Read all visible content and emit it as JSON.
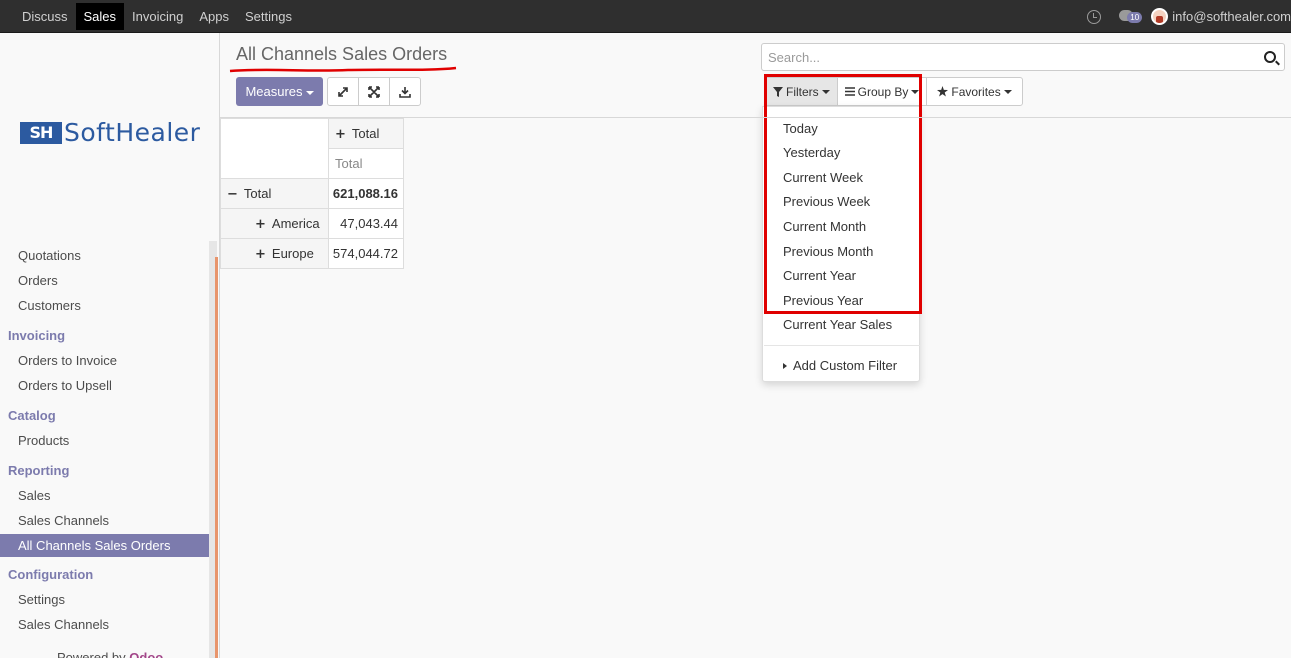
{
  "topbar": {
    "menu": [
      "Discuss",
      "Sales",
      "Invoicing",
      "Apps",
      "Settings"
    ],
    "active_menu": "Sales",
    "chat_count": "10",
    "user_email": "info@softhealer.com"
  },
  "logo": {
    "mark": "SH",
    "word": "SoftHealer"
  },
  "sidebar": {
    "items": [
      {
        "type": "item",
        "label": "Quotations"
      },
      {
        "type": "item",
        "label": "Orders"
      },
      {
        "type": "item",
        "label": "Customers"
      },
      {
        "type": "section",
        "label": "Invoicing"
      },
      {
        "type": "item",
        "label": "Orders to Invoice"
      },
      {
        "type": "item",
        "label": "Orders to Upsell"
      },
      {
        "type": "section",
        "label": "Catalog"
      },
      {
        "type": "item",
        "label": "Products"
      },
      {
        "type": "section",
        "label": "Reporting"
      },
      {
        "type": "item",
        "label": "Sales"
      },
      {
        "type": "item",
        "label": "Sales Channels"
      },
      {
        "type": "item",
        "label": "All Channels Sales Orders",
        "active": true
      },
      {
        "type": "section",
        "label": "Configuration"
      },
      {
        "type": "item",
        "label": "Settings"
      },
      {
        "type": "item",
        "label": "Sales Channels"
      }
    ],
    "powered_prefix": "Powered by ",
    "powered_brand": "Odoo"
  },
  "page": {
    "title": "All Channels Sales Orders"
  },
  "toolbar": {
    "measures_label": "Measures"
  },
  "search": {
    "placeholder": "Search..."
  },
  "filters": {
    "filters_label": "Filters",
    "groupby_label": "Group By",
    "favorites_label": "Favorites",
    "options": [
      "Today",
      "Yesterday",
      "Current Week",
      "Previous Week",
      "Current Month",
      "Previous Month",
      "Current Year",
      "Previous Year",
      "Current Year Sales"
    ],
    "custom_label": "Add Custom Filter"
  },
  "pivot": {
    "col_header": "Total",
    "measure_header": "Total",
    "total_label": "Total",
    "total_value": "621,088.16",
    "rows": [
      {
        "label": "America",
        "value": "47,043.44"
      },
      {
        "label": "Europe",
        "value": "574,044.72"
      }
    ]
  },
  "colors": {
    "accent": "#7c7bad",
    "highlight": "#e00000",
    "topbar": "#2f2f2f"
  }
}
